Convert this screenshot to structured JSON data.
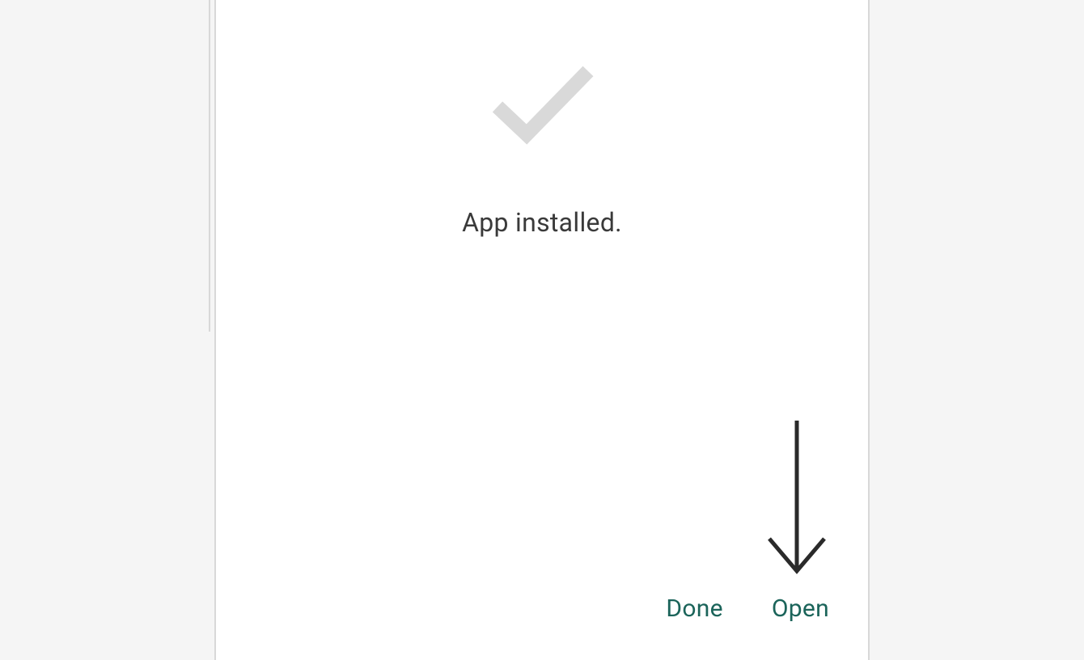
{
  "dialog": {
    "status_message": "App installed.",
    "buttons": {
      "done_label": "Done",
      "open_label": "Open"
    }
  },
  "icons": {
    "checkmark": "checkmark-icon",
    "arrow": "arrow-down-icon"
  },
  "colors": {
    "accent": "#1b645a",
    "text": "#3a3a3a",
    "icon_muted": "#d9d9d9",
    "border": "#d8d8d8",
    "background": "#f5f5f5",
    "dialog_bg": "#ffffff"
  }
}
